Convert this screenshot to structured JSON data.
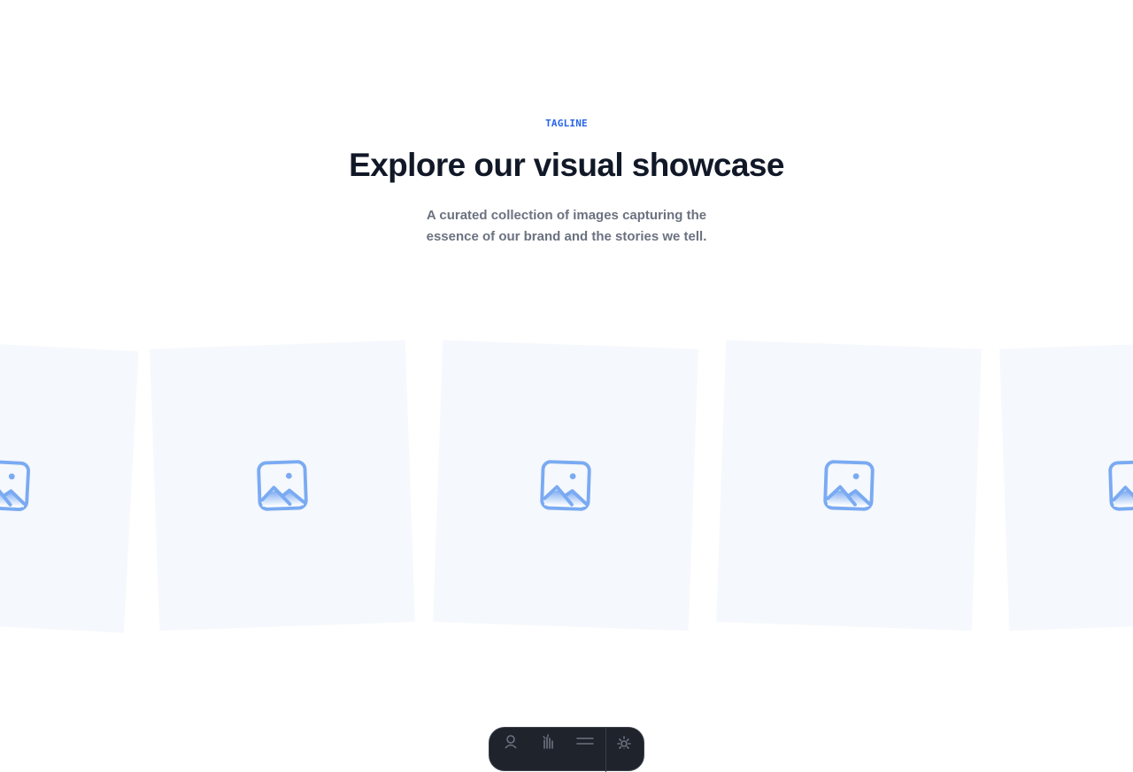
{
  "hero": {
    "tagline": "TAGLINE",
    "title": "Explore our visual showcase",
    "subtitle": "A curated collection of images capturing the essence of our brand and the stories we tell."
  },
  "gallery": {
    "cards": [
      {
        "icon": "image-placeholder-icon"
      },
      {
        "icon": "image-placeholder-icon"
      },
      {
        "icon": "image-placeholder-icon"
      },
      {
        "icon": "image-placeholder-icon"
      },
      {
        "icon": "image-placeholder-icon"
      }
    ]
  },
  "toolbar": {
    "buttons": [
      {
        "icon": "user-icon"
      },
      {
        "icon": "hand-icon"
      },
      {
        "icon": "menu-icon"
      },
      {
        "icon": "settings-icon"
      }
    ]
  },
  "colors": {
    "accent": "#2563eb",
    "heading": "#111827",
    "body_text": "#6b7280",
    "card_bg": "#f5f8fc",
    "icon": "#7aaaf2",
    "toolbar_bg": "#1f232b"
  }
}
